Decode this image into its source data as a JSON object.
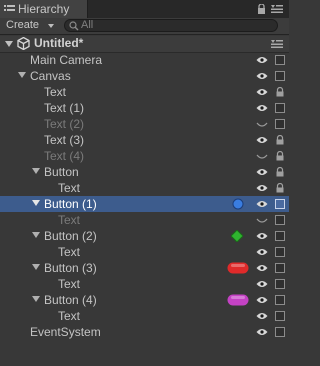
{
  "window": {
    "tab_label": "Hierarchy",
    "create_label": "Create",
    "search_placeholder": "All"
  },
  "scene": {
    "name": "Untitled*"
  },
  "rows": [
    {
      "label": "Main Camera",
      "depth": 1,
      "fold": "none",
      "dim": false,
      "selected": false,
      "eye": "open",
      "lock": "box",
      "badge": "none"
    },
    {
      "label": "Canvas",
      "depth": 1,
      "fold": "open",
      "dim": false,
      "selected": false,
      "eye": "open",
      "lock": "box",
      "badge": "none"
    },
    {
      "label": "Text",
      "depth": 2,
      "fold": "none",
      "dim": false,
      "selected": false,
      "eye": "open",
      "lock": "locked",
      "badge": "none"
    },
    {
      "label": "Text (1)",
      "depth": 2,
      "fold": "none",
      "dim": false,
      "selected": false,
      "eye": "open",
      "lock": "box",
      "badge": "none"
    },
    {
      "label": "Text (2)",
      "depth": 2,
      "fold": "none",
      "dim": true,
      "selected": false,
      "eye": "closed",
      "lock": "box",
      "badge": "none"
    },
    {
      "label": "Text (3)",
      "depth": 2,
      "fold": "none",
      "dim": false,
      "selected": false,
      "eye": "open",
      "lock": "locked",
      "badge": "none"
    },
    {
      "label": "Text (4)",
      "depth": 2,
      "fold": "none",
      "dim": true,
      "selected": false,
      "eye": "closed",
      "lock": "locked",
      "badge": "none"
    },
    {
      "label": "Button",
      "depth": 2,
      "fold": "open",
      "dim": false,
      "selected": false,
      "eye": "open",
      "lock": "locked",
      "badge": "none"
    },
    {
      "label": "Text",
      "depth": 3,
      "fold": "none",
      "dim": false,
      "selected": false,
      "eye": "open",
      "lock": "locked",
      "badge": "none"
    },
    {
      "label": "Button (1)",
      "depth": 2,
      "fold": "open",
      "dim": false,
      "selected": true,
      "eye": "open",
      "lock": "box",
      "badge": "blue-circle"
    },
    {
      "label": "Text",
      "depth": 3,
      "fold": "none",
      "dim": true,
      "selected": false,
      "eye": "closed",
      "lock": "box",
      "badge": "none"
    },
    {
      "label": "Button (2)",
      "depth": 2,
      "fold": "open",
      "dim": false,
      "selected": false,
      "eye": "open",
      "lock": "box",
      "badge": "green-diamond"
    },
    {
      "label": "Text",
      "depth": 3,
      "fold": "none",
      "dim": false,
      "selected": false,
      "eye": "open",
      "lock": "box",
      "badge": "none"
    },
    {
      "label": "Button (3)",
      "depth": 2,
      "fold": "open",
      "dim": false,
      "selected": false,
      "eye": "open",
      "lock": "box",
      "badge": "red-pill"
    },
    {
      "label": "Text",
      "depth": 3,
      "fold": "none",
      "dim": false,
      "selected": false,
      "eye": "open",
      "lock": "box",
      "badge": "none"
    },
    {
      "label": "Button (4)",
      "depth": 2,
      "fold": "open",
      "dim": false,
      "selected": false,
      "eye": "open",
      "lock": "box",
      "badge": "magenta-pill"
    },
    {
      "label": "Text",
      "depth": 3,
      "fold": "none",
      "dim": false,
      "selected": false,
      "eye": "open",
      "lock": "box",
      "badge": "none"
    },
    {
      "label": "EventSystem",
      "depth": 1,
      "fold": "none",
      "dim": false,
      "selected": false,
      "eye": "open",
      "lock": "box",
      "badge": "none"
    }
  ],
  "colors": {
    "background": "#383838",
    "selection": "#3d5c8d",
    "badge_blue": "#3a7de0",
    "badge_green": "#2fb52f",
    "badge_red": "#e02a2a",
    "badge_magenta": "#c442c4"
  }
}
